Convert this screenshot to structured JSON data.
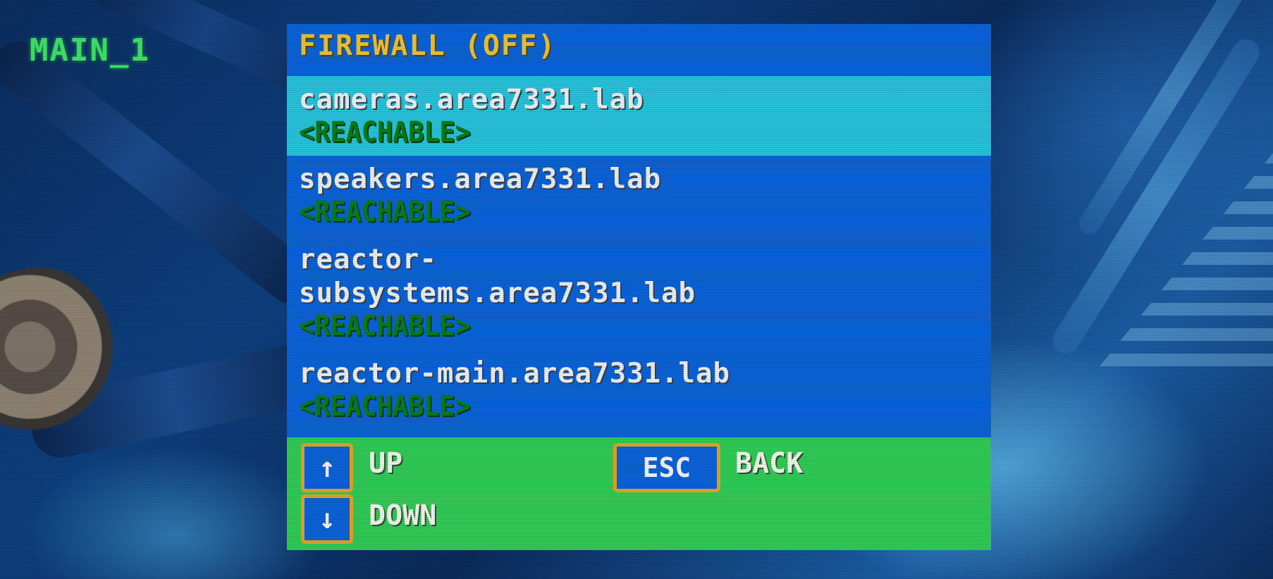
{
  "camera_label": "MAIN_1",
  "terminal": {
    "title": "FIREWALL (OFF)",
    "hosts": [
      {
        "name": "cameras.area7331.lab",
        "status": "<REACHABLE>",
        "selected": true
      },
      {
        "name": "speakers.area7331.lab",
        "status": "<REACHABLE>",
        "selected": false
      },
      {
        "name": "reactor-\nsubsystems.area7331.lab",
        "status": "<REACHABLE>",
        "selected": false
      },
      {
        "name": "reactor-main.area7331.lab",
        "status": "<REACHABLE>",
        "selected": false
      }
    ]
  },
  "controls": {
    "up_key": "↑",
    "up_label": "UP",
    "down_key": "↓",
    "down_label": "DOWN",
    "esc_key": "ESC",
    "back_label": "BACK"
  },
  "colors": {
    "panel_blue": "#0b61d6",
    "selected_cyan": "#27c1d9",
    "header_yellow": "#e8c23a",
    "status_green": "#0a7b18",
    "controls_green": "#31c955",
    "key_border_orange": "#e0a227",
    "camera_label_green": "#3ee06a"
  }
}
